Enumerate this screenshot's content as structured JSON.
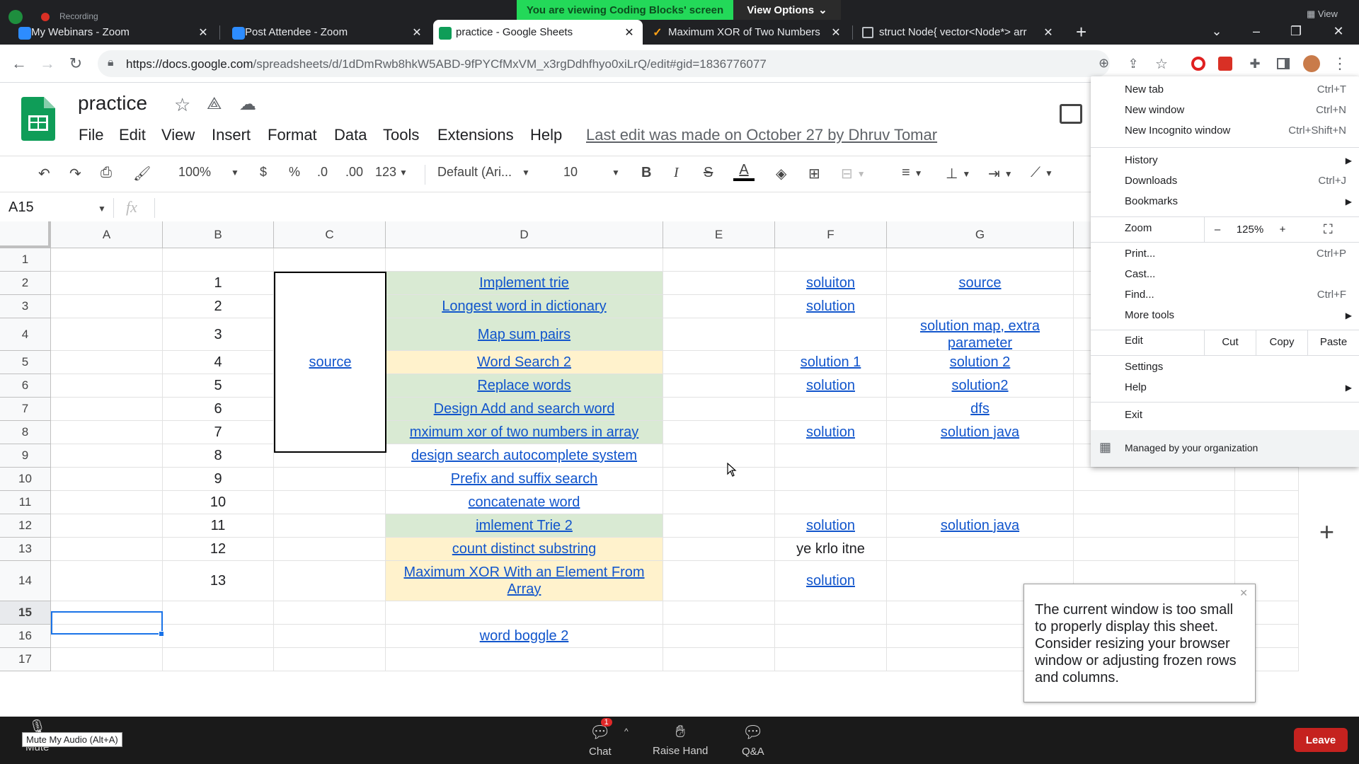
{
  "screen_share": {
    "recording_label": "Recording",
    "banner": "You are viewing Coding Blocks' screen",
    "view_options": "View Options",
    "view_corner": "View"
  },
  "browser": {
    "tabs": [
      {
        "label": "My Webinars - Zoom",
        "icon": "zoom-icon",
        "active": false
      },
      {
        "label": "Post Attendee - Zoom",
        "icon": "zoom-icon",
        "active": false
      },
      {
        "label": "practice - Google Sheets",
        "icon": "sheets-icon",
        "active": true
      },
      {
        "label": "Maximum XOR of Two Numbers",
        "icon": "leetcode-icon",
        "active": false
      },
      {
        "label": "struct Node{ vector<Node*> arr",
        "icon": "page-icon",
        "active": false
      }
    ],
    "url_host": "https://docs.google.com",
    "url_path": "/spreadsheets/d/1dDmRwb8hkW5ABD-9fPYCfMxVM_x3rgDdhfhyo0xiLrQ/edit#gid=1836776077"
  },
  "sheets": {
    "title": "practice",
    "menu": [
      "File",
      "Edit",
      "View",
      "Insert",
      "Format",
      "Data",
      "Tools",
      "Extensions",
      "Help"
    ],
    "last_edit": "Last edit was made on October 27 by Dhruv Tomar",
    "toolbar": {
      "zoom": "100%",
      "currency": "$",
      "percent": "%",
      "dec_decrease": ".0",
      "dec_increase": ".00",
      "format_more": "123",
      "font": "Default (Ari...",
      "font_size": "10",
      "bold": "B",
      "italic": "I",
      "strike": "S",
      "text_color": "A"
    },
    "name_box": "A15",
    "fx": "fx",
    "columns": [
      "A",
      "B",
      "C",
      "D",
      "E",
      "F",
      "G"
    ],
    "rows": [
      "1",
      "2",
      "3",
      "4",
      "5",
      "6",
      "7",
      "8",
      "9",
      "10",
      "11",
      "12",
      "13",
      "14",
      "15",
      "16",
      "17"
    ],
    "cells": {
      "b": [
        "",
        "1",
        "2",
        "3",
        "4",
        "5",
        "6",
        "7",
        "8",
        "9",
        "10",
        "11",
        "12",
        "13",
        "",
        "",
        ""
      ],
      "c_merged": "source",
      "d": [
        "",
        "Implement trie",
        "Longest word in dictionary",
        "Map sum pairs",
        "Word Search 2",
        "Replace words",
        "Design Add and search word",
        "mximum xor of two numbers in array",
        "design search autocomplete system",
        "Prefix and suffix search",
        "concatenate word",
        "imlement Trie 2",
        "count distinct substring",
        "Maximum XOR With an Element From Array",
        "",
        "word boggle 2",
        ""
      ],
      "f": [
        "",
        "soluiton",
        "solution",
        "",
        "solution 1",
        "solution",
        "",
        "solution",
        "",
        "",
        "",
        "solution",
        "ye krlo itne",
        "solution",
        "",
        "",
        ""
      ],
      "g": [
        "",
        "source",
        "",
        "solution map, extra parameter",
        "solution 2",
        "solution2",
        "dfs",
        "solution java",
        "",
        "",
        "",
        "solution java",
        "",
        "",
        "",
        "",
        ""
      ]
    },
    "row_colors": {
      "green": "#d9ead3",
      "yellow": "#fff2cc"
    },
    "warning": "The current window is too small to properly display this sheet. Consider resizing your browser window or adjusting frozen rows and columns."
  },
  "chrome_menu": {
    "items": [
      {
        "label": "New tab",
        "shortcut": "Ctrl+T"
      },
      {
        "label": "New window",
        "shortcut": "Ctrl+N"
      },
      {
        "label": "New Incognito window",
        "shortcut": "Ctrl+Shift+N"
      },
      {
        "label": "History",
        "shortcut": ""
      },
      {
        "label": "Downloads",
        "shortcut": "Ctrl+J"
      },
      {
        "label": "Bookmarks",
        "shortcut": ""
      },
      {
        "label": "Print...",
        "shortcut": "Ctrl+P"
      },
      {
        "label": "Cast...",
        "shortcut": ""
      },
      {
        "label": "Find...",
        "shortcut": "Ctrl+F"
      },
      {
        "label": "More tools",
        "shortcut": ""
      },
      {
        "label": "Settings",
        "shortcut": ""
      },
      {
        "label": "Help",
        "shortcut": ""
      },
      {
        "label": "Exit",
        "shortcut": ""
      }
    ],
    "zoom_label": "Zoom",
    "zoom_minus": "–",
    "zoom_value": "125%",
    "zoom_plus": "+",
    "edit_label": "Edit",
    "cut": "Cut",
    "copy": "Copy",
    "paste": "Paste",
    "managed": "Managed by your organization"
  },
  "zoom_meeting": {
    "mute_tooltip": "Mute My Audio (Alt+A)",
    "mute": "Mute",
    "chat": "Chat",
    "chat_badge": "1",
    "raise_hand": "Raise Hand",
    "qa": "Q&A",
    "leave": "Leave",
    "leave_color": "#c5221f"
  }
}
